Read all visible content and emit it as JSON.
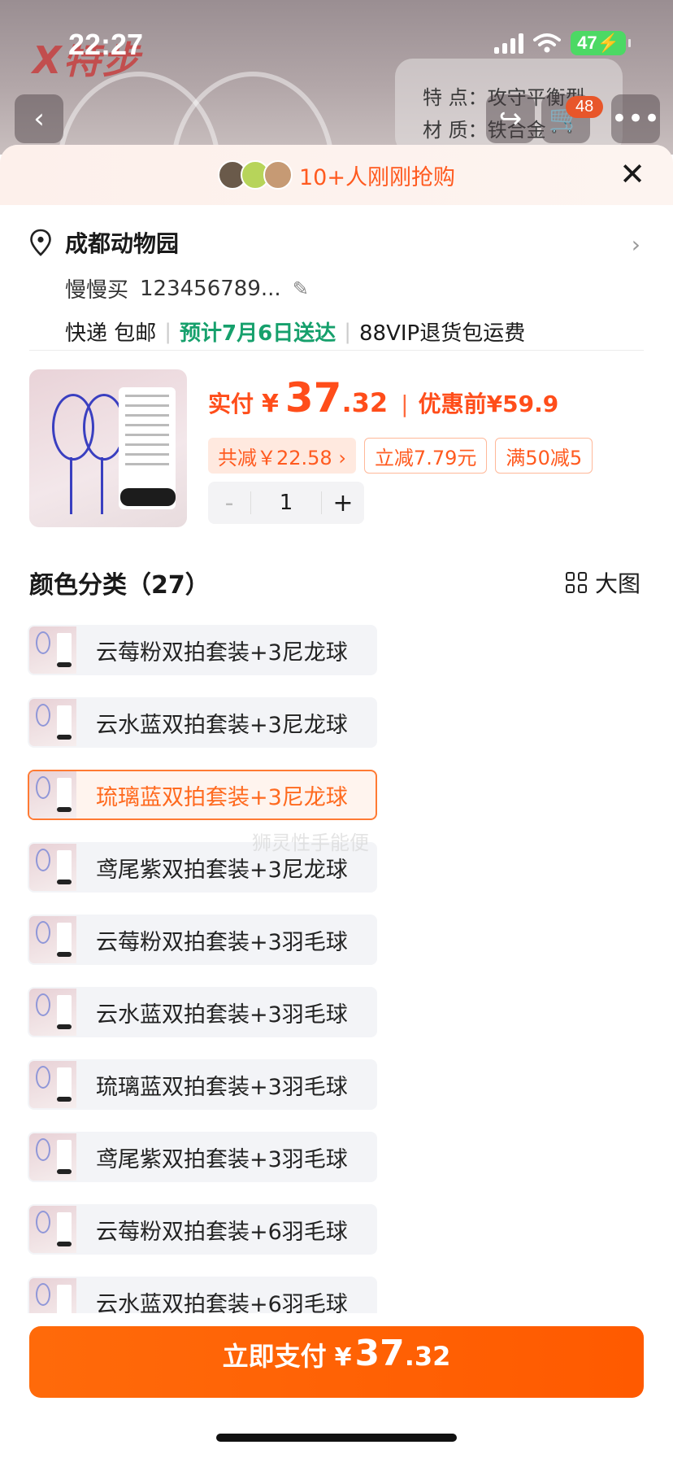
{
  "status_bar": {
    "time": "22:27",
    "battery": "47"
  },
  "background_page": {
    "brand": "X特步",
    "spec_lines": [
      "特 点：攻守平衡型",
      "材 质：铁合金"
    ],
    "cart_badge": "48"
  },
  "sheet": {
    "header_text": "10+人刚刚抢购",
    "close": "✕"
  },
  "address": {
    "name": "成都动物园",
    "recipient": "慢慢买",
    "phone": "123456789...",
    "shipping_method": "快递 包邮",
    "delivery_estimate": "预计7月6日送达",
    "return_policy": "88VIP退货包运费"
  },
  "product": {
    "price_label": "实付",
    "currency": "¥",
    "price_int": "37",
    "price_dec": ".32",
    "original_label": "优惠前",
    "original_price": "¥59.9",
    "total_discount": "共减￥22.58 ›",
    "coupon1": "立减7.79元",
    "coupon2": "满50减5",
    "quantity": "1",
    "minus": "-",
    "plus": "+"
  },
  "options_section": {
    "title": "颜色分类（27）",
    "big_view_label": "大图",
    "selected_index": 2,
    "items": [
      "云莓粉双拍套装+3尼龙球",
      "云水蓝双拍套装+3尼龙球",
      "琉璃蓝双拍套装+3尼龙球",
      "鸢尾紫双拍套装+3尼龙球",
      "云莓粉双拍套装+3羽毛球",
      "云水蓝双拍套装+3羽毛球",
      "琉璃蓝双拍套装+3羽毛球",
      "鸢尾紫双拍套装+3羽毛球",
      "云莓粉双拍套装+6羽毛球",
      "云水蓝双拍套装+6羽毛球"
    ]
  },
  "watermark": "狮灵性手能便",
  "pay_button": {
    "label": "立即支付",
    "currency": "¥",
    "int": "37",
    "dec": ".32"
  },
  "colors": {
    "accent": "#ff5a00",
    "green": "#16a06c"
  }
}
